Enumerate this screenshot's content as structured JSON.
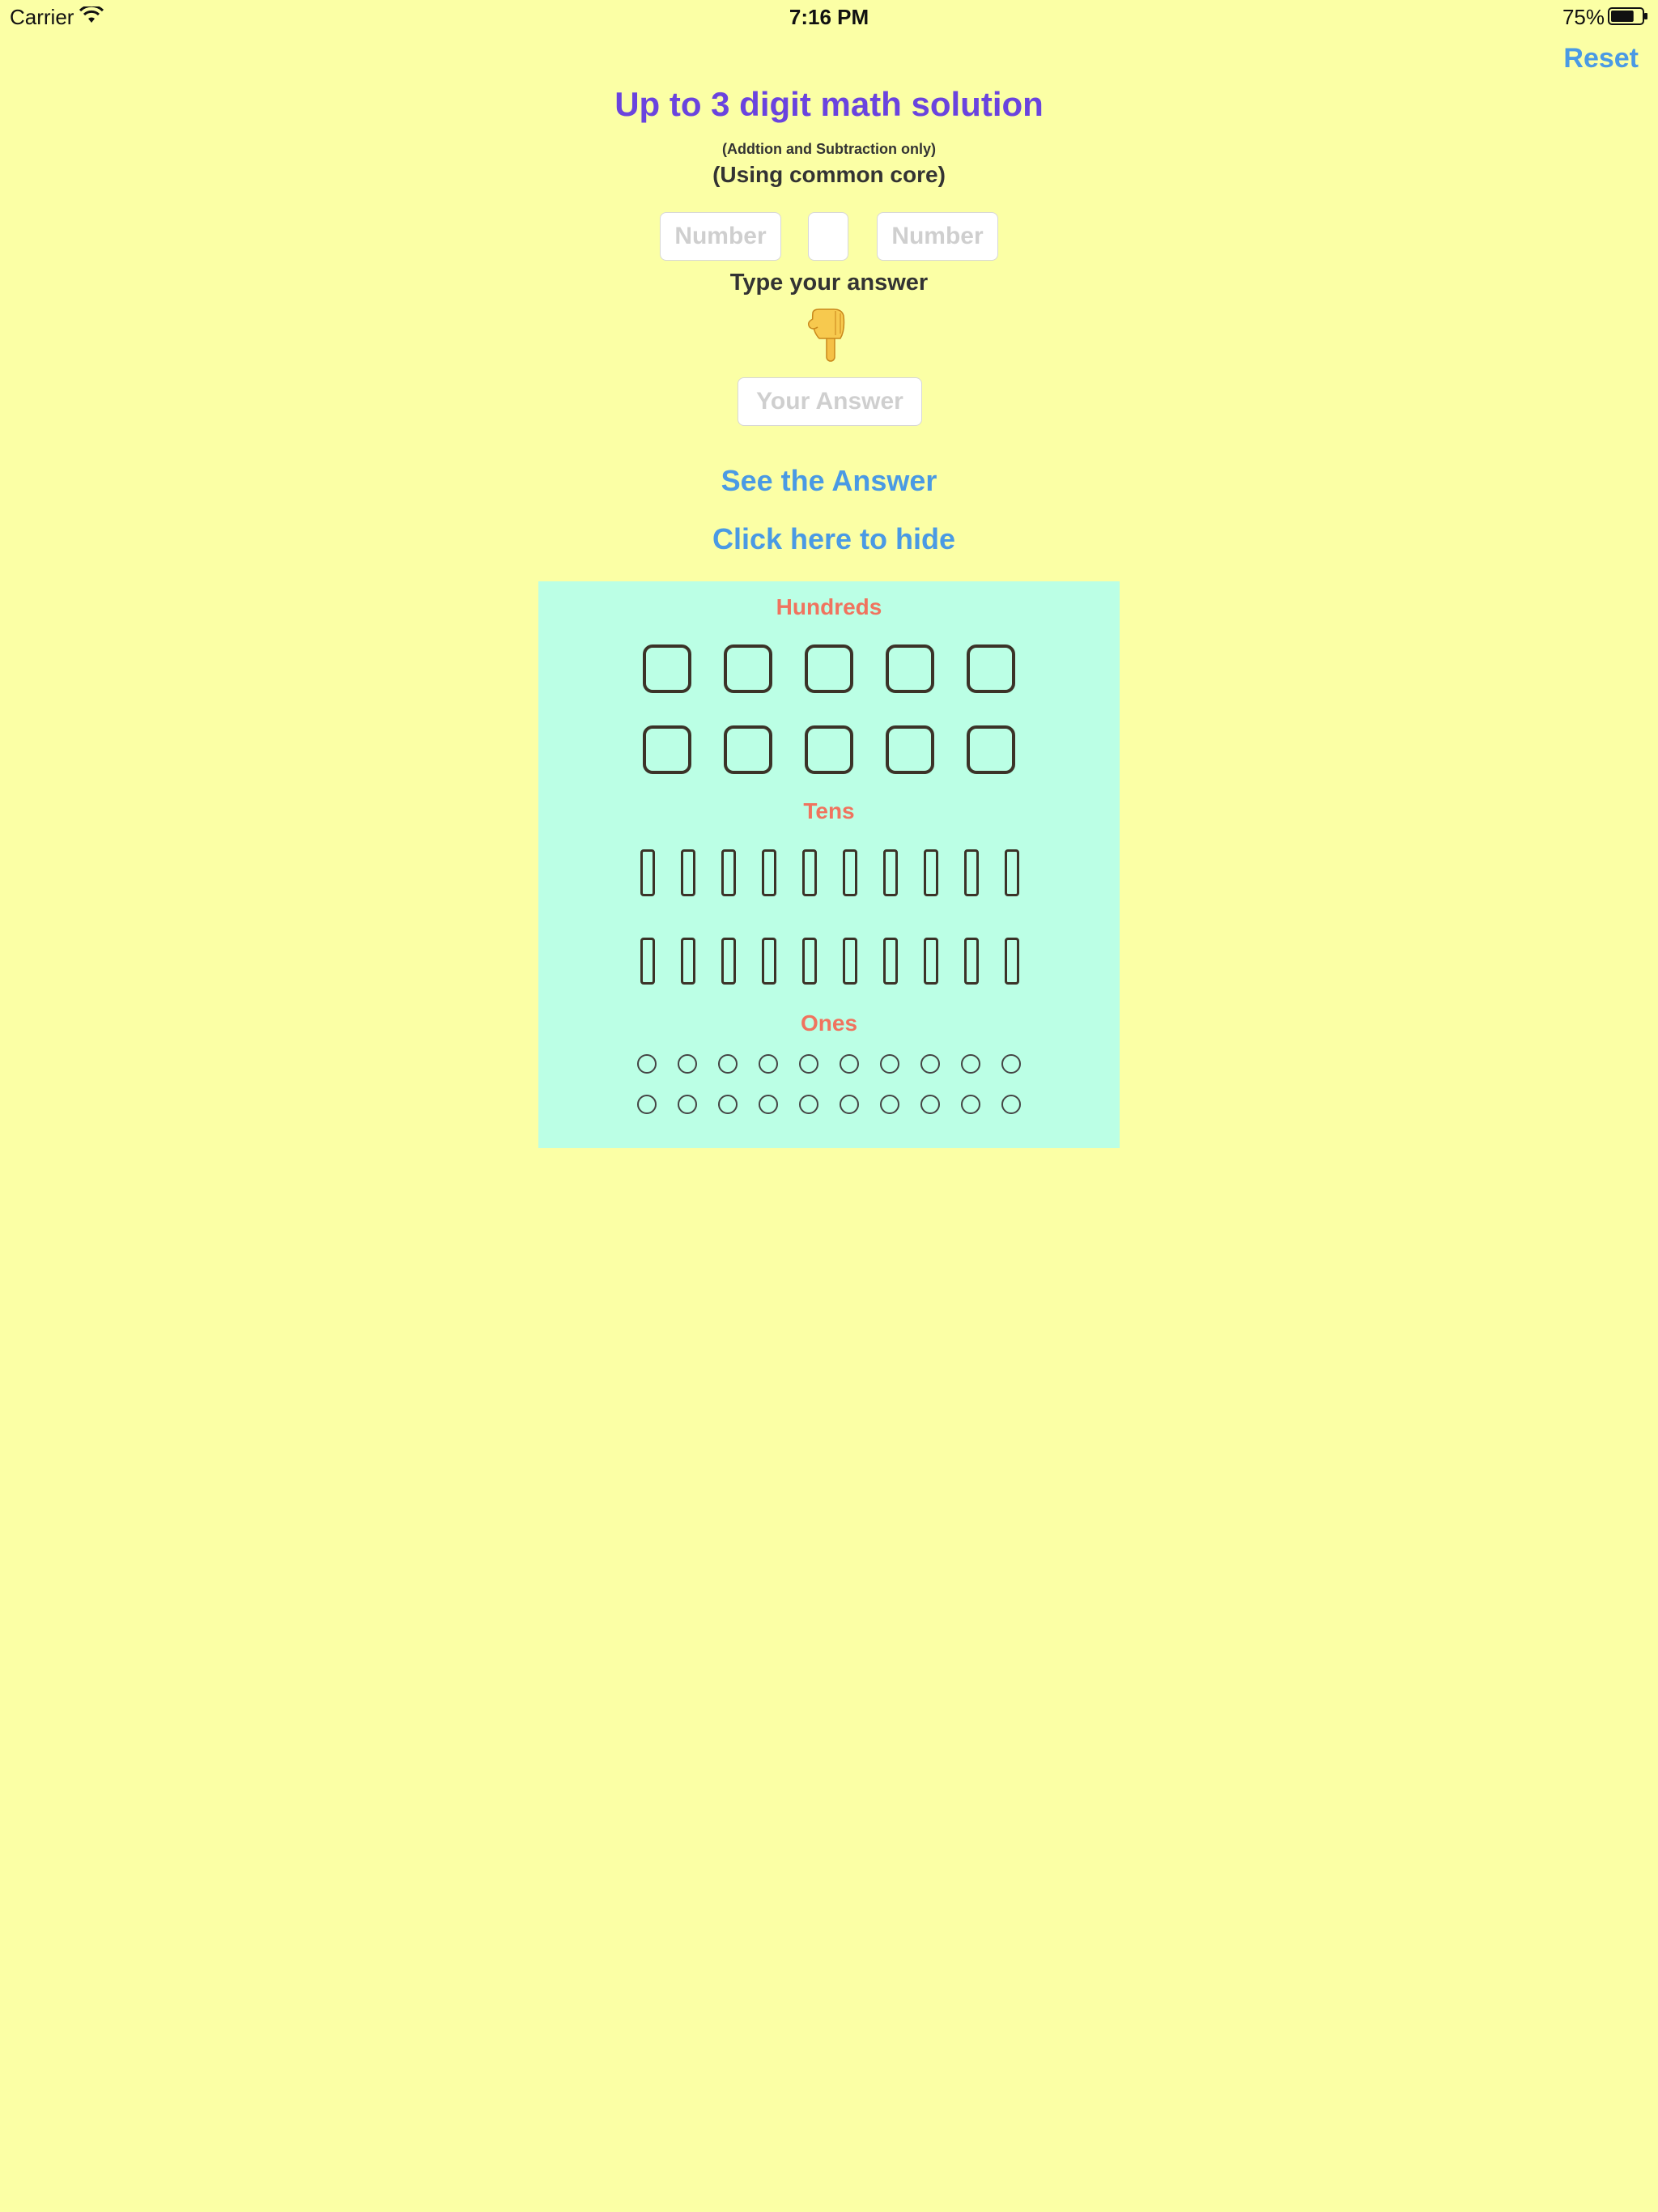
{
  "status_bar": {
    "carrier": "Carrier",
    "time": "7:16 PM",
    "battery": "75%",
    "battery_level": 0.75,
    "wifi_icon": "wifi-icon",
    "battery_icon": "battery-icon"
  },
  "header": {
    "reset_label": "Reset"
  },
  "title": "Up to 3 digit math solution",
  "subtitle_small": "(Addtion and Subtraction only)",
  "subtitle": "(Using common core)",
  "inputs": {
    "number1_placeholder": "Number",
    "operator_value": "",
    "number2_placeholder": "Number",
    "answer_placeholder": "Your Answer"
  },
  "prompt": "Type your answer",
  "pointer_icon": "backhand-index-pointing-down-icon",
  "actions": {
    "see_answer": "See the Answer",
    "hide": "Click here to hide"
  },
  "place_value": {
    "hundreds_label": "Hundreds",
    "tens_label": "Tens",
    "ones_label": "Ones",
    "hundreds_count": 10,
    "tens_count": 20,
    "ones_count": 20
  },
  "colors": {
    "background": "#fbffa5",
    "title": "#6a44de",
    "link": "#4a9ae4",
    "panel": "#bbffe5",
    "section_label": "#f0735e"
  }
}
